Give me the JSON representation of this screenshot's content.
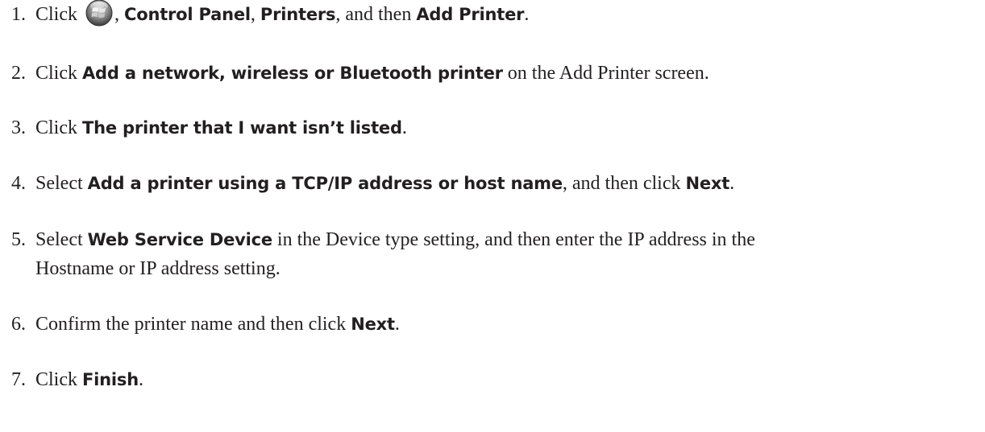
{
  "steps": [
    {
      "num": "1.",
      "parts": [
        "Click ",
        "",
        ", ",
        "Control Panel",
        ", ",
        "Printers",
        ", and then ",
        "Add Printer",
        "."
      ]
    },
    {
      "num": "2.",
      "parts": [
        "Click ",
        "Add a network, wireless or Bluetooth printer",
        " on the Add Printer screen."
      ]
    },
    {
      "num": "3.",
      "parts": [
        "Click ",
        "The printer that I want isn’t listed",
        "."
      ]
    },
    {
      "num": "4.",
      "parts": [
        "Select ",
        "Add a printer using a TCP/IP address or host name",
        ", and then click ",
        "Next",
        "."
      ]
    },
    {
      "num": "5.",
      "parts": [
        "Select ",
        "Web Service Device",
        " in the Device type setting, and then enter the IP address in the"
      ],
      "line2": "Hostname or IP address setting."
    },
    {
      "num": "6.",
      "parts": [
        "Confirm the printer name and then click ",
        "Next",
        "."
      ]
    },
    {
      "num": "7.",
      "parts": [
        "Click ",
        "Finish",
        "."
      ]
    }
  ],
  "icons": {
    "start_button": "windows-start-orb-icon"
  }
}
